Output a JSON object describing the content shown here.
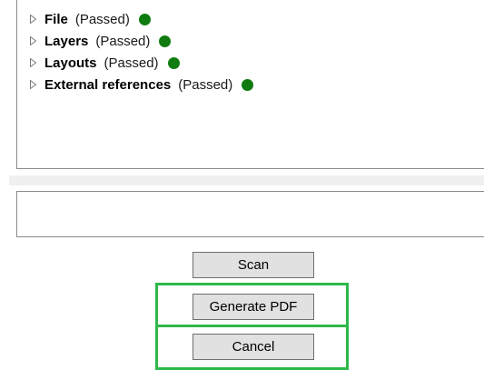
{
  "tree": {
    "items": [
      {
        "name": "File",
        "status": "(Passed)"
      },
      {
        "name": "Layers",
        "status": "(Passed)"
      },
      {
        "name": "Layouts",
        "status": "(Passed)"
      },
      {
        "name": "External references",
        "status": "(Passed)"
      }
    ],
    "arrow_icon": "triangle-right-outline-icon",
    "status_icon": "status-dot-icon"
  },
  "message": {
    "text": ""
  },
  "buttons": {
    "scan_label": "Scan",
    "generate_pdf_label": "Generate PDF",
    "cancel_label": "Cancel"
  },
  "colors": {
    "passed_dot": "#107c10",
    "highlight_border": "#2eb84a",
    "button_bg": "#e1e1e1",
    "panel_border": "#8a8a8a",
    "separator": "#f0f0f0"
  }
}
